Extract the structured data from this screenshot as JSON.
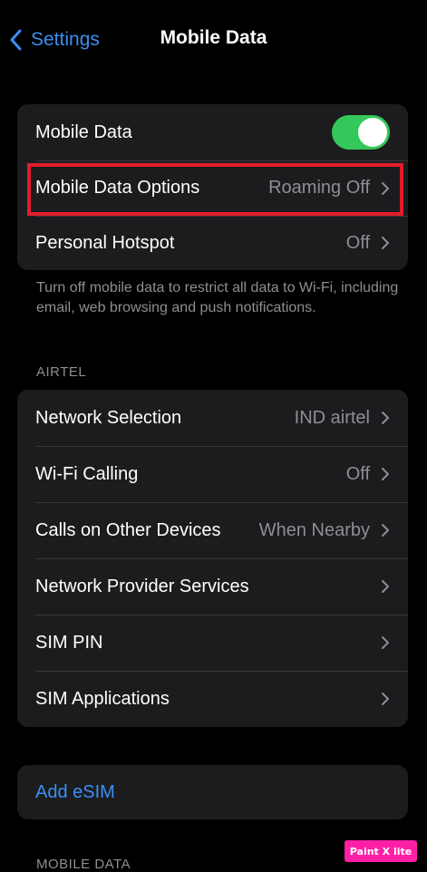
{
  "nav": {
    "back_label": "Settings",
    "title": "Mobile Data"
  },
  "group1": {
    "mobile_data": {
      "label": "Mobile Data",
      "toggle_on": true
    },
    "mobile_data_options": {
      "label": "Mobile Data Options",
      "value": "Roaming Off"
    },
    "personal_hotspot": {
      "label": "Personal Hotspot",
      "value": "Off"
    }
  },
  "footnote": "Turn off mobile data to restrict all data to Wi-Fi, including email, web browsing and push notifications.",
  "section_airtel": "AIRTEL",
  "group2": [
    {
      "label": "Network Selection",
      "value": "IND airtel"
    },
    {
      "label": "Wi-Fi Calling",
      "value": "Off"
    },
    {
      "label": "Calls on Other Devices",
      "value": "When Nearby"
    },
    {
      "label": "Network Provider Services",
      "value": ""
    },
    {
      "label": "SIM PIN",
      "value": ""
    },
    {
      "label": "SIM Applications",
      "value": ""
    }
  ],
  "add_esim": "Add eSIM",
  "section_mobile_data": "MOBILE DATA",
  "watermark": "Paint X lite",
  "colors": {
    "accent": "#3a8ff5",
    "toggle": "#34c759",
    "highlight": "#e11d2b",
    "watermark": "#ff1fa6"
  }
}
